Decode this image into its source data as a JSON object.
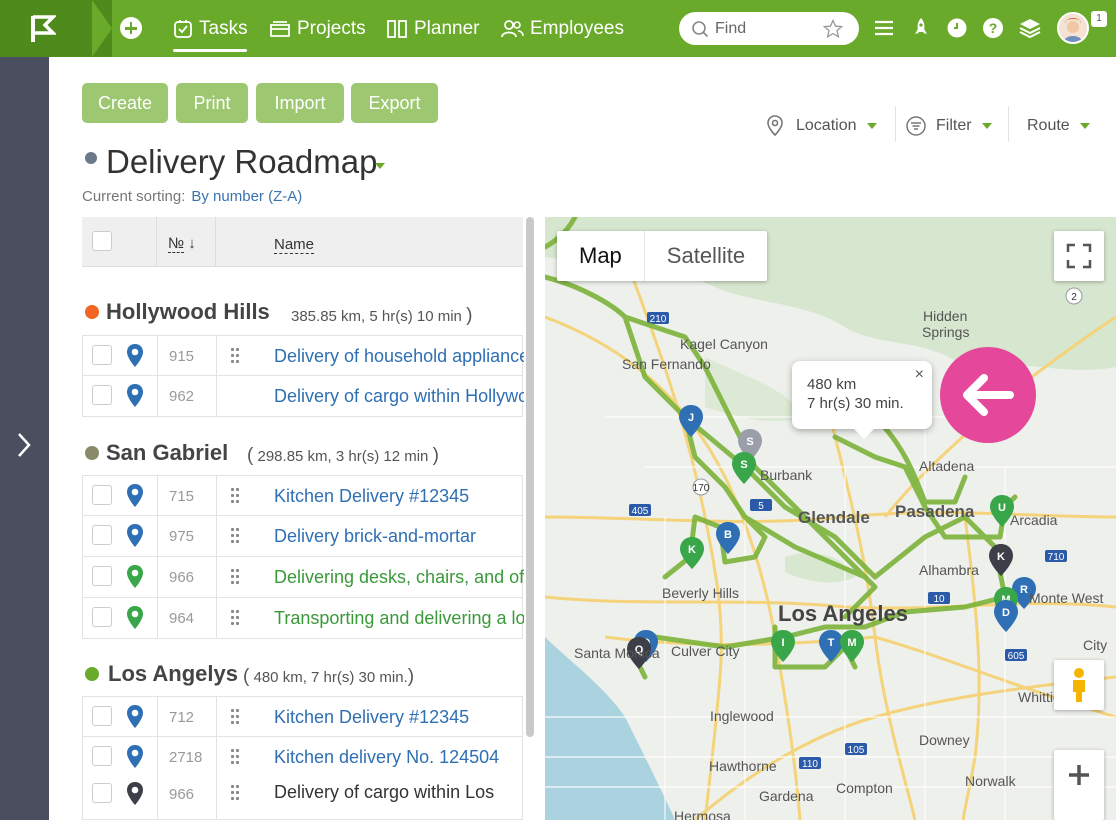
{
  "nav": {
    "items": [
      {
        "label": "Tasks",
        "icon": "tasks-icon",
        "active": true
      },
      {
        "label": "Projects",
        "icon": "projects-icon"
      },
      {
        "label": "Planner",
        "icon": "planner-icon"
      },
      {
        "label": "Employees",
        "icon": "employees-icon"
      }
    ],
    "search_placeholder": "Find",
    "notification_count": "1"
  },
  "toolbar": {
    "create": "Create",
    "print": "Print",
    "import": "Import",
    "export": "Export",
    "location": "Location",
    "filter": "Filter",
    "route": "Route"
  },
  "page": {
    "title": "Delivery Roadmap",
    "sorting_label": "Current sorting:",
    "sorting_value": "By number (Z-A)"
  },
  "table": {
    "col_number": "№",
    "col_sort_arrow": "↓",
    "col_name": "Name"
  },
  "groups": [
    {
      "name": "Hollywood Hills",
      "meta_open": "",
      "meta": "385.85 km, 5 hr(s) 10 min",
      "meta_close": ")",
      "color": "#f26522",
      "rows": [
        {
          "num": "915",
          "name": "Delivery of household appliances",
          "pin": "blue"
        },
        {
          "num": "962",
          "name": "Delivery of cargo within Hollywood",
          "pin": "blue"
        }
      ]
    },
    {
      "name": "San Gabriel",
      "meta_open": "(",
      "meta": "298.85 km, 3 hr(s) 12 min",
      "meta_close": ")",
      "color": "#8a8a6a",
      "rows": [
        {
          "num": "715",
          "name": "Kitchen Delivery #12345",
          "pin": "blue"
        },
        {
          "num": "975",
          "name": "Delivery brick-and-mortar",
          "pin": "blue"
        },
        {
          "num": "966",
          "name": "Delivering desks, chairs, and office",
          "pin": "green"
        },
        {
          "num": "964",
          "name": "Transporting and delivering a lot",
          "pin": "green"
        }
      ]
    },
    {
      "name": "Los Angelys",
      "meta_open": "(",
      "meta": "480 km, 7 hr(s) 30 min.",
      "meta_close": ")",
      "color": "#6aaa2a",
      "rows": [
        {
          "num": "712",
          "name": "Kitchen Delivery #12345",
          "pin": "blue"
        },
        {
          "num": "2718",
          "name": "Kitchen delivery No. 124504",
          "pin": "blue"
        },
        {
          "num": "966",
          "name": "Delivery of cargo within Los",
          "pin": "dark"
        }
      ]
    }
  ],
  "map": {
    "type_map": "Map",
    "type_satellite": "Satellite",
    "popup_distance": "480 km",
    "popup_time": "7 hr(s) 30 min.",
    "popup_close": "×",
    "labels": {
      "kagel": "Kagel Canyon",
      "sanfernando": "San Fernando",
      "hidden1": "Hidden",
      "hidden2": "Springs",
      "altadena": "Altadena",
      "burbank": "Burbank",
      "glendale": "Glendale",
      "pasadena": "Pasadena",
      "arcadia": "Arcadia",
      "alhambra": "Alhambra",
      "beverly": "Beverly Hills",
      "losangeles": "Los Angeles",
      "montewest": "Monte West",
      "santamonica": "Santa Monica",
      "culver": "Culver City",
      "inglewood": "Inglewood",
      "downey": "Downey",
      "hawthorne": "Hawthorne",
      "norwalk": "Norwalk",
      "gardena": "Gardena",
      "compton": "Compton",
      "whittier": "Whittie",
      "city": "City",
      "hermosa": "Hermosa"
    },
    "route_color": "#7cb33a",
    "pin_colors": {
      "blue": "#2f6fb4",
      "green": "#3aa64a",
      "dark": "#3c3f48"
    }
  },
  "colors": {
    "brand": "#6aaa2a",
    "accent": "#e5479a",
    "rail": "#4b4e5e",
    "button": "#9dc770"
  }
}
